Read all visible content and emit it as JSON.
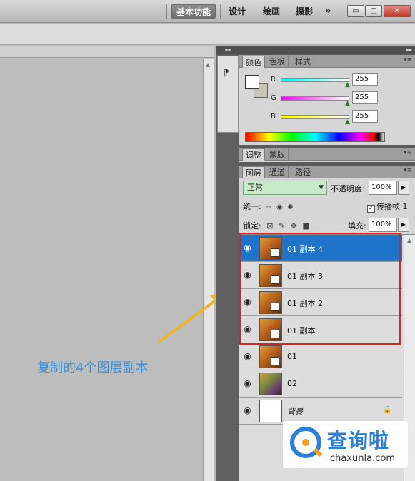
{
  "topbar": {
    "workspaces": [
      "基本功能",
      "设计",
      "绘画",
      "摄影"
    ],
    "more": "»",
    "window_buttons": {
      "minimize": "▭",
      "maximize": "□",
      "close": "✕"
    }
  },
  "annotation": {
    "text": "复制的4个图层副本",
    "color": "#3a8fd6"
  },
  "color_panel": {
    "tabs": [
      "颜色",
      "色板",
      "样式"
    ],
    "menu": "▾≡",
    "channels": [
      {
        "label": "R",
        "value": "255",
        "gradient": "linear-gradient(90deg,#00ffff,#ffffff)"
      },
      {
        "label": "G",
        "value": "255",
        "gradient": "linear-gradient(90deg,#ff00ff,#ffffff)"
      },
      {
        "label": "B",
        "value": "255",
        "gradient": "linear-gradient(90deg,#ffff00,#ffffff)"
      }
    ],
    "foreground": "#ffffff",
    "background": "#c7c5b6"
  },
  "adjust_panel": {
    "tabs": [
      "调整",
      "蒙版"
    ],
    "menu": "▾≡"
  },
  "layers_panel": {
    "tabs": [
      "图层",
      "通道",
      "路径"
    ],
    "menu": "▾≡",
    "blend_mode": "正常",
    "opacity_label": "不透明度:",
    "opacity": "100%",
    "unify_label": "统一:",
    "propagate_label": "传播帧 1",
    "propagate_check": "✓",
    "lock_label": "锁定:",
    "fill_label": "填充:",
    "fill": "100%",
    "layers": [
      {
        "name": "01 副本 4",
        "selected": true
      },
      {
        "name": "01 副本 3",
        "selected": false
      },
      {
        "name": "01 副本 2",
        "selected": false
      },
      {
        "name": "01 副本",
        "selected": false
      },
      {
        "name": "01",
        "selected": false
      },
      {
        "name": "02",
        "selected": false
      },
      {
        "name": "背景",
        "selected": false
      }
    ],
    "highlight_color": "#e02020",
    "selected_color": "#1f73c9"
  },
  "watermark": {
    "name": "查询啦",
    "url": "chaxunla.com"
  }
}
